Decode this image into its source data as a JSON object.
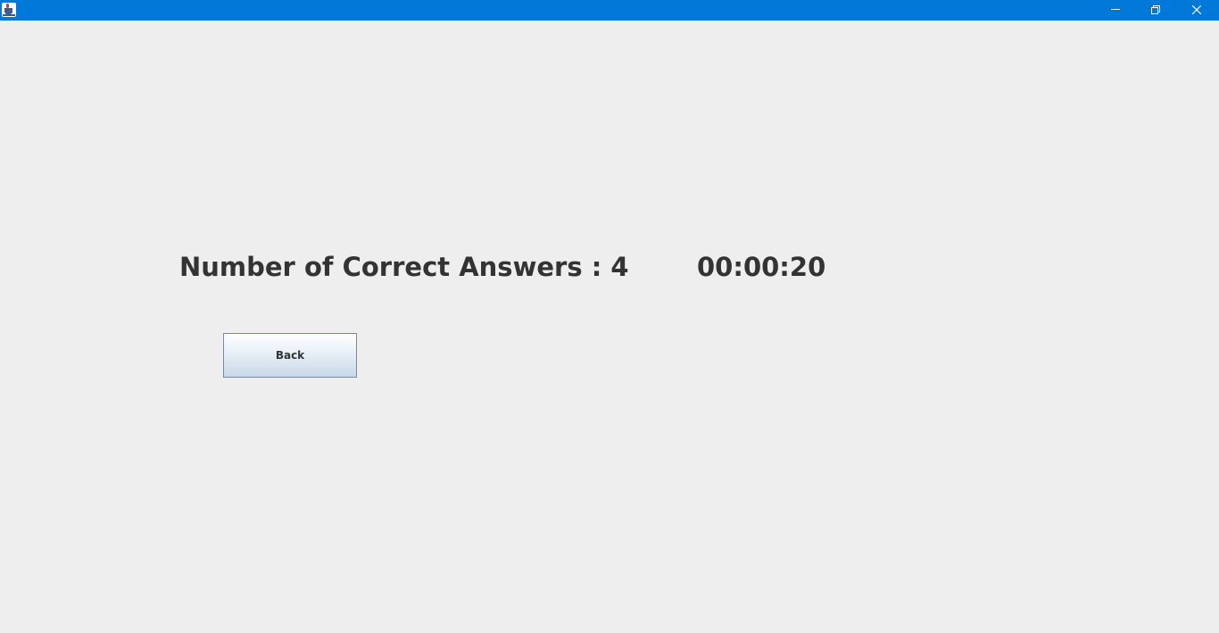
{
  "window": {
    "title": "",
    "app_icon": "java-coffee-cup-icon",
    "controls": {
      "minimize_icon": "minimize-icon",
      "maximize_icon": "restore-icon",
      "close_icon": "close-icon"
    },
    "titlebar_color": "#0078d7",
    "background_color": "#eeeeee"
  },
  "result": {
    "correct_answers_text": "Number of Correct Answers : 4",
    "elapsed_time": "00:00:20"
  },
  "actions": {
    "back_label": "Back"
  }
}
